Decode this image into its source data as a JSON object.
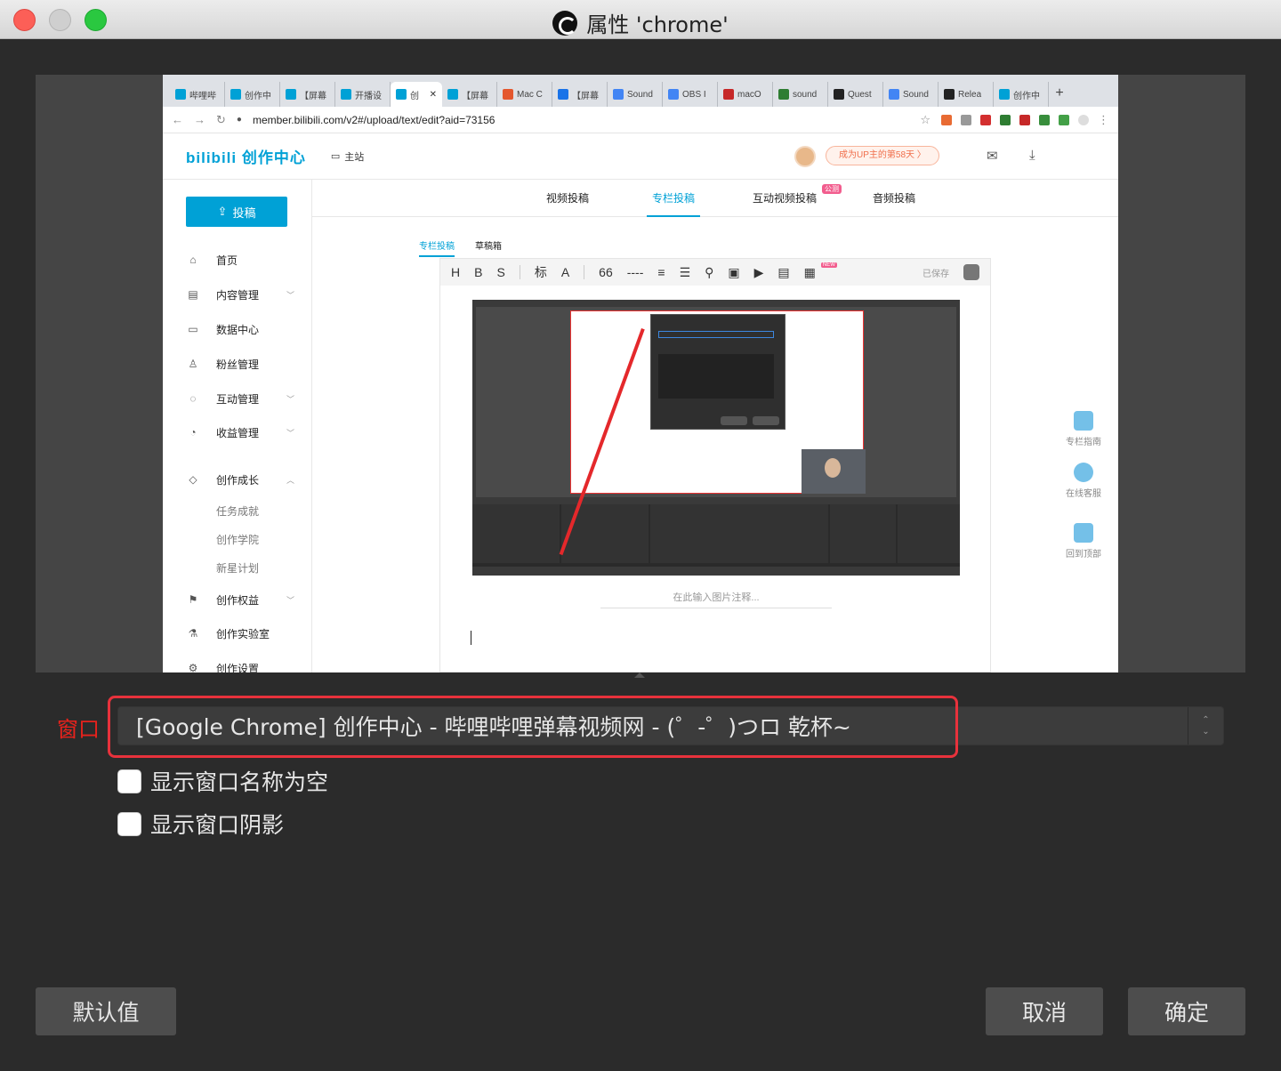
{
  "window": {
    "title": "属性 'chrome'"
  },
  "browser": {
    "tabs": [
      {
        "label": "哔哩哔",
        "color": "#00a1d6"
      },
      {
        "label": "创作中",
        "color": "#00a1d6"
      },
      {
        "label": "【屏幕",
        "color": "#00a1d6"
      },
      {
        "label": "开播设",
        "color": "#00a1d6"
      },
      {
        "label": "创",
        "color": "#00a1d6",
        "active": true
      },
      {
        "label": "【屏幕",
        "color": "#00a1d6"
      },
      {
        "label": "Mac C",
        "color": "#e4572e"
      },
      {
        "label": "【屏幕",
        "color": "#1a73e8"
      },
      {
        "label": "Sound",
        "color": "#4285f4"
      },
      {
        "label": "OBS I",
        "color": "#4285f4"
      },
      {
        "label": "macO",
        "color": "#c62828"
      },
      {
        "label": "sound",
        "color": "#2e7d32"
      },
      {
        "label": "Quest",
        "color": "#222222"
      },
      {
        "label": "Sound",
        "color": "#4285f4"
      },
      {
        "label": "Relea",
        "color": "#222222"
      },
      {
        "label": "创作中",
        "color": "#00a1d6"
      }
    ],
    "new_tab": "+",
    "url": "member.bilibili.com/v2#/upload/text/edit?aid=73156"
  },
  "bili": {
    "logo": "bilibili 创作中心",
    "home": "主站",
    "up_badge": "成为UP主的第58天 〉",
    "upload_button": "投稿",
    "sidebar": [
      {
        "label": "首页",
        "icon": "home-icon"
      },
      {
        "label": "内容管理",
        "icon": "content-icon",
        "chevron": "﹀"
      },
      {
        "label": "数据中心",
        "icon": "data-icon"
      },
      {
        "label": "粉丝管理",
        "icon": "fans-icon"
      },
      {
        "label": "互动管理",
        "icon": "interact-icon",
        "chevron": "﹀"
      },
      {
        "label": "收益管理",
        "icon": "money-icon",
        "chevron": "﹀"
      },
      {
        "label": "创作成长",
        "icon": "growth-icon",
        "chevron": "︿"
      },
      {
        "label": "创作权益",
        "icon": "flag-icon",
        "chevron": "﹀"
      },
      {
        "label": "创作实验室",
        "icon": "lab-icon"
      },
      {
        "label": "创作设置",
        "icon": "settings-icon"
      }
    ],
    "sidebar_sub": [
      "任务成就",
      "创作学院",
      "新星计划"
    ],
    "main_tabs": [
      "视频投稿",
      "专栏投稿",
      "互动视频投稿",
      "音频投稿"
    ],
    "main_tab_badge": "公测",
    "sub_tabs": [
      "专栏投稿",
      "草稿箱"
    ],
    "toolbar": [
      "H",
      "B",
      "S",
      "标",
      "A",
      "66",
      "----",
      "≡",
      "☰",
      "⚲",
      "▣",
      "▶",
      "▤",
      "▦"
    ],
    "toolbar_new": "NEW",
    "saved": "已保存",
    "caption_placeholder": "在此输入图片注释...",
    "float_tools": [
      "专栏指南",
      "在线客服",
      "回到顶部"
    ]
  },
  "form": {
    "window_label": "窗口",
    "window_value": "[Google Chrome] 创作中心 - 哔哩哔哩弹幕视频网 - (゜-゜)つロ 乾杯~",
    "check1": "显示窗口名称为空",
    "check2": "显示窗口阴影"
  },
  "buttons": {
    "defaults": "默认值",
    "cancel": "取消",
    "ok": "确定"
  }
}
